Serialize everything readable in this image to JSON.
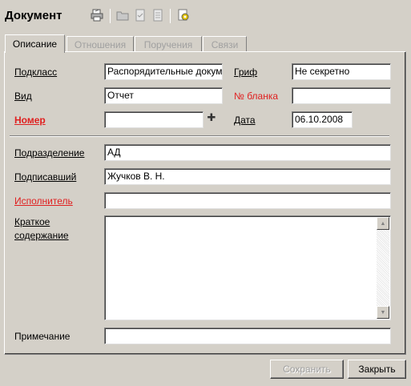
{
  "window": {
    "title": "Документ"
  },
  "toolbar": {
    "icons": [
      "print-icon",
      "folder-icon",
      "checklist-icon",
      "document-icon",
      "settings-icon"
    ]
  },
  "tabs": [
    {
      "label": "Описание",
      "active": true
    },
    {
      "label": "Отношения",
      "active": false
    },
    {
      "label": "Поручения",
      "active": false
    },
    {
      "label": "Связи",
      "active": false
    }
  ],
  "form": {
    "podklass": {
      "label": "Подкласс",
      "value": "Распорядительные докум"
    },
    "vid": {
      "label": "Вид",
      "value": "Отчет"
    },
    "nomer": {
      "label": "Номер",
      "value": ""
    },
    "grif": {
      "label": "Гриф",
      "value": "Не секретно"
    },
    "nomer_blanka": {
      "label": "№ бланка",
      "value": ""
    },
    "data": {
      "label": "Дата",
      "value": "06.10.2008"
    },
    "podrazdelenie": {
      "label": "Подразделение",
      "value": "АД"
    },
    "podpisavshiy": {
      "label": "Подписавший",
      "value": "Жучков В. Н."
    },
    "ispolnitel": {
      "label": "Исполнитель",
      "value": ""
    },
    "kratkoe_line1": "Краткое",
    "kratkoe_line2": "содержание",
    "kratkoe_value": "",
    "primechanie": {
      "label": "Примечание",
      "value": ""
    }
  },
  "buttons": {
    "save": "Сохранить",
    "close": "Закрыть"
  },
  "colors": {
    "background": "#d4d0c8",
    "required_label": "#e02020",
    "disabled_text": "#a0a0a0"
  }
}
